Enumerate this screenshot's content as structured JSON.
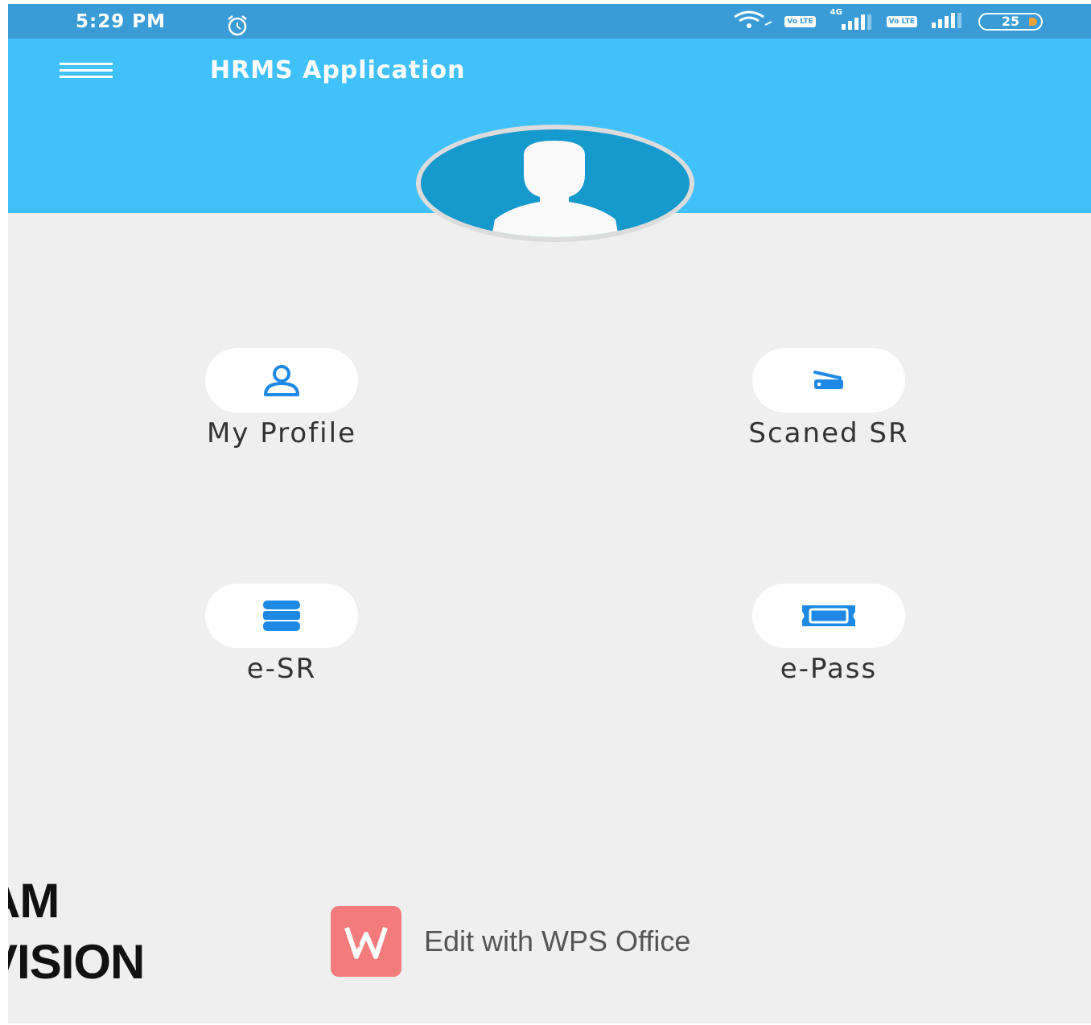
{
  "status_bar": {
    "time": "5:29 PM",
    "icons": [
      "alarm-icon",
      "wifi-icon",
      "volte-icon",
      "signal-icon",
      "volte-icon",
      "signal-icon",
      "battery-icon"
    ],
    "network_label": "4G",
    "volte_label": "Vo LTE",
    "battery_percent": "25"
  },
  "app_bar": {
    "title": "HRMS Application",
    "menu_icon": "hamburger-menu-icon"
  },
  "profile": {
    "avatar_icon": "user-silhouette-icon"
  },
  "tiles": [
    {
      "label": "My Profile",
      "icon": "user-outline-icon"
    },
    {
      "label": "Scaned SR",
      "icon": "scanner-icon"
    },
    {
      "label": "e-SR",
      "icon": "database-icon"
    },
    {
      "label": "e-Pass",
      "icon": "ticket-icon"
    }
  ],
  "overlay": {
    "line1": "AM",
    "line2": "VISION"
  },
  "watermark": {
    "text": "Edit with WPS Office",
    "icon": "wps-logo-icon"
  },
  "colors": {
    "status_bar": "#3a9cd6",
    "app_bar": "#41c1fb",
    "avatar": "#1699cc",
    "icon_blue": "#1e88e5",
    "background": "#efefef",
    "wps": "#f47b7b"
  }
}
